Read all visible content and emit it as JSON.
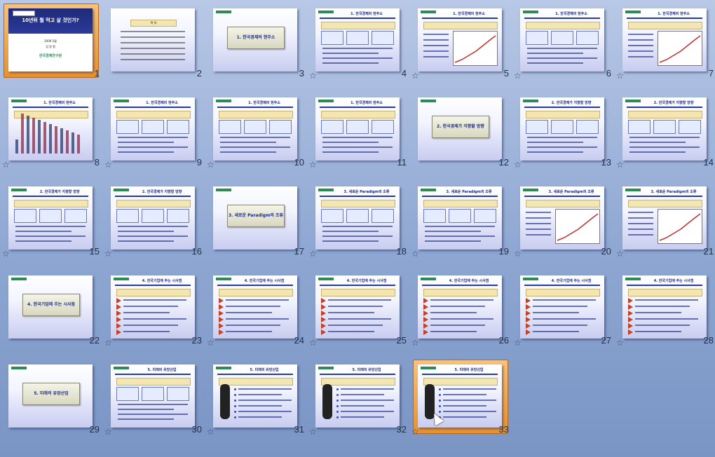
{
  "slides": [
    {
      "num": "1",
      "title": "10년뒤 뭘 먹고 살 것인가?",
      "date": "2006.5월",
      "author": "임 명 철",
      "org": "한국경제연구원",
      "selected_style": "title",
      "star": false
    },
    {
      "num": "2",
      "title": "목 차",
      "star": false,
      "type": "toc"
    },
    {
      "num": "3",
      "title": "1. 한국경제의 현주소",
      "star": false,
      "type": "section"
    },
    {
      "num": "4",
      "title": "1. 한국경제의 현주소",
      "star": true,
      "type": "content"
    },
    {
      "num": "5",
      "title": "1. 한국경제의 현주소",
      "star": true,
      "type": "chart"
    },
    {
      "num": "6",
      "title": "1. 한국경제의 현주소",
      "star": true,
      "type": "content"
    },
    {
      "num": "7",
      "title": "1. 한국경제의 현주소",
      "star": true,
      "type": "chart"
    },
    {
      "num": "8",
      "title": "1. 한국경제의 현주소",
      "star": true,
      "type": "bars"
    },
    {
      "num": "9",
      "title": "1. 한국경제의 현주소",
      "star": true,
      "type": "content"
    },
    {
      "num": "10",
      "title": "1. 한국경제의 현주소",
      "star": true,
      "type": "content"
    },
    {
      "num": "11",
      "title": "1. 한국경제의 현주소",
      "star": true,
      "type": "content"
    },
    {
      "num": "12",
      "title": "2. 한국경제가 지향할 방향",
      "star": false,
      "type": "section"
    },
    {
      "num": "13",
      "title": "2. 한국경제가 지향할 방향",
      "star": true,
      "type": "content"
    },
    {
      "num": "14",
      "title": "2. 한국경제가 지향할 방향",
      "star": true,
      "type": "content"
    },
    {
      "num": "15",
      "title": "2. 한국경제가 지향할 방향",
      "star": true,
      "type": "content"
    },
    {
      "num": "16",
      "title": "2. 한국경제가 지향할 방향",
      "star": true,
      "type": "content"
    },
    {
      "num": "17",
      "title": "3. 새로운 Paradigm의 조류",
      "star": false,
      "type": "section"
    },
    {
      "num": "18",
      "title": "3. 새로운 Paradigm의 조류",
      "star": true,
      "type": "content"
    },
    {
      "num": "19",
      "title": "3. 새로운 Paradigm의 조류",
      "star": true,
      "type": "content"
    },
    {
      "num": "20",
      "title": "3. 새로운 Paradigm의 조류",
      "star": true,
      "type": "chart"
    },
    {
      "num": "21",
      "title": "3. 새로운 Paradigm의 조류",
      "star": true,
      "type": "chart"
    },
    {
      "num": "22",
      "title": "4. 한국기업에 주는 시사점",
      "star": false,
      "type": "section"
    },
    {
      "num": "23",
      "title": "4. 한국기업에 주는 시사점",
      "star": true,
      "type": "bullets"
    },
    {
      "num": "24",
      "title": "4. 한국기업에 주는 시사점",
      "star": true,
      "type": "bullets"
    },
    {
      "num": "25",
      "title": "4. 한국기업에 주는 시사점",
      "star": true,
      "type": "bullets"
    },
    {
      "num": "26",
      "title": "4. 한국기업에 주는 시사점",
      "star": true,
      "type": "bullets"
    },
    {
      "num": "27",
      "title": "4. 한국기업에 주는 시사점",
      "star": true,
      "type": "bullets"
    },
    {
      "num": "28",
      "title": "4. 한국기업에 주는 시사점",
      "star": true,
      "type": "bullets"
    },
    {
      "num": "29",
      "title": "5. 미래의 유망산업",
      "star": false,
      "type": "section"
    },
    {
      "num": "30",
      "title": "5. 미래의 유망산업",
      "star": true,
      "type": "content"
    },
    {
      "num": "31",
      "title": "5. 미래의 유망산업",
      "star": true,
      "type": "figure"
    },
    {
      "num": "32",
      "title": "5. 미래의 유망산업",
      "star": true,
      "type": "figure"
    },
    {
      "num": "33",
      "title": "5. 미래의 유망산업",
      "star": true,
      "type": "figure",
      "selected": true
    }
  ],
  "star_glyph": "☆",
  "colors": {
    "selection": "#e8912e",
    "title_blue": "#1b2a8a"
  }
}
